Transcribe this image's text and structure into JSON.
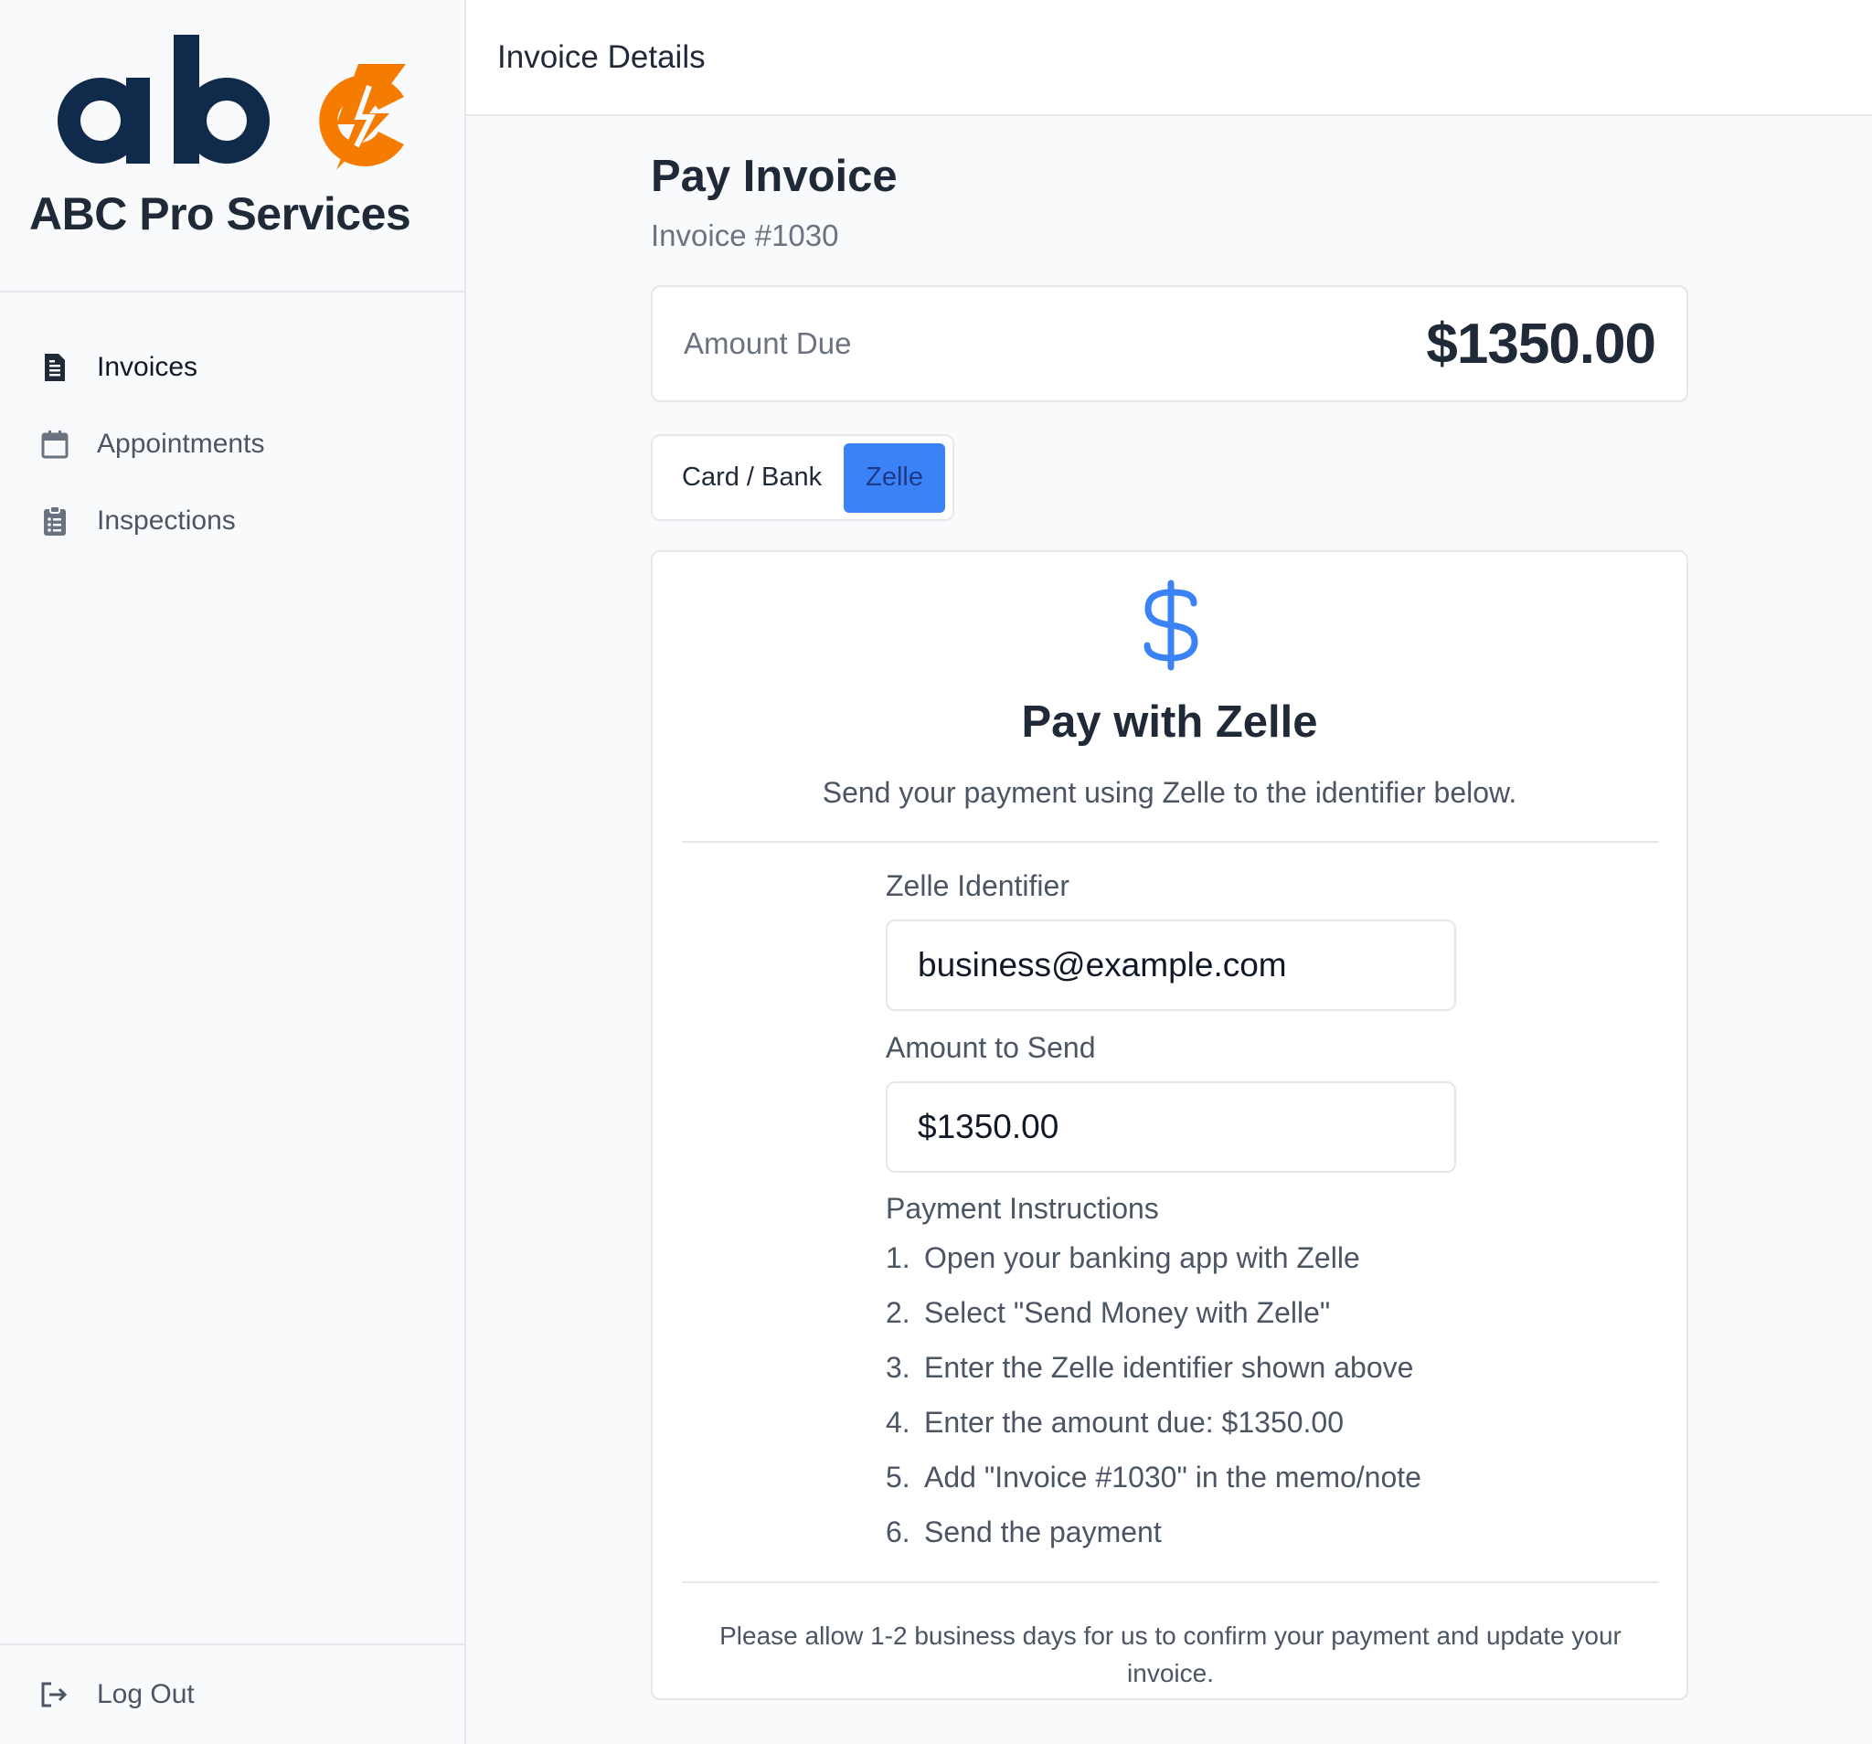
{
  "brand": {
    "name": "ABC Pro Services",
    "logo_text": "abc",
    "logo_color_dark": "#0f2a4a",
    "logo_color_accent": "#f57c00"
  },
  "sidebar": {
    "items": [
      {
        "label": "Invoices",
        "icon": "document-icon",
        "active": true
      },
      {
        "label": "Appointments",
        "icon": "calendar-icon",
        "active": false
      },
      {
        "label": "Inspections",
        "icon": "clipboard-icon",
        "active": false
      }
    ],
    "logout_label": "Log Out",
    "logout_icon": "logout-icon"
  },
  "header": {
    "title": "Invoice Details"
  },
  "main": {
    "title": "Pay Invoice",
    "invoice_number": "Invoice #1030",
    "amount_due_label": "Amount Due",
    "amount_due_value": "$1350.00",
    "tabs": [
      {
        "label": "Card / Bank",
        "selected": false
      },
      {
        "label": "Zelle",
        "selected": true
      }
    ],
    "zelle": {
      "icon": "dollar-icon",
      "title": "Pay with Zelle",
      "subtitle": "Send your payment using Zelle to the identifier below.",
      "identifier_label": "Zelle Identifier",
      "identifier_value": "business@example.com",
      "amount_label": "Amount to Send",
      "amount_value": "$1350.00",
      "instructions_title": "Payment Instructions",
      "instructions": [
        {
          "num": "1.",
          "text": "Open your banking app with Zelle"
        },
        {
          "num": "2.",
          "text": "Select \"Send Money with Zelle\""
        },
        {
          "num": "3.",
          "text": "Enter the Zelle identifier shown above"
        },
        {
          "num": "4.",
          "text": "Enter the amount due: $1350.00"
        },
        {
          "num": "5.",
          "text": "Add \"Invoice #1030\" in the memo/note"
        },
        {
          "num": "6.",
          "text": "Send the payment"
        }
      ],
      "footnote": "Please allow 1-2 business days for us to confirm your payment and update your invoice."
    }
  },
  "colors": {
    "accent_blue": "#3b82f6",
    "tab_selected_text": "#1e3a8a",
    "border": "#e5e7eb"
  }
}
